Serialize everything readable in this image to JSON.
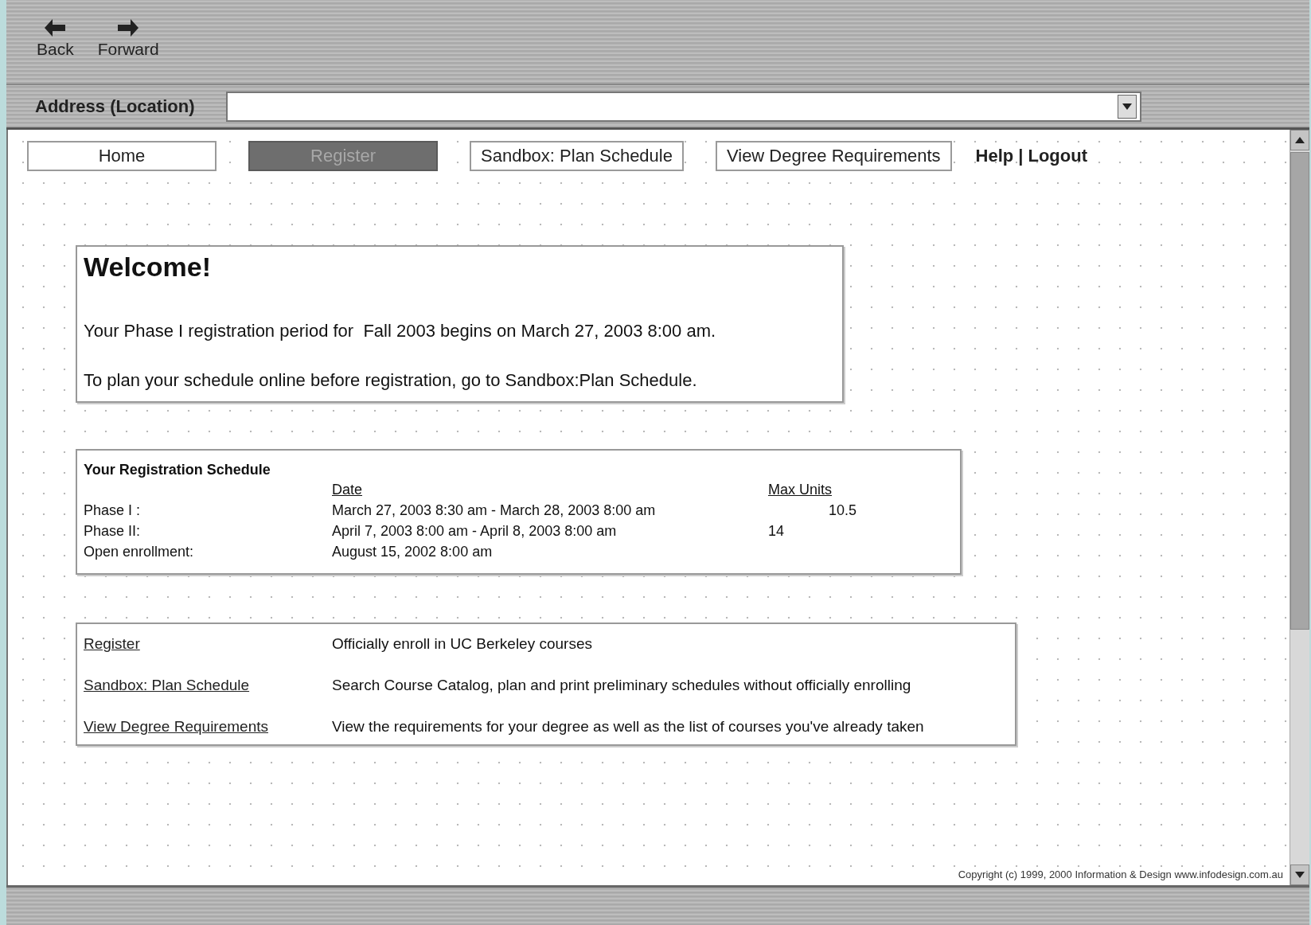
{
  "toolbar": {
    "buttons": [
      {
        "label": "Back",
        "kind": "back"
      },
      {
        "label": "Forward",
        "kind": "forward"
      }
    ]
  },
  "address_bar": {
    "label": "Address (Location)"
  },
  "nav": {
    "tabs": [
      {
        "label": "Home",
        "selected": false
      },
      {
        "label": "Register",
        "selected": true
      },
      {
        "label": "Sandbox: Plan Schedule",
        "selected": false
      },
      {
        "label": "View Degree Requirements",
        "selected": false
      }
    ],
    "links": [
      "Help",
      "Logout"
    ],
    "separator": "|"
  },
  "welcome": {
    "title": "Welcome!",
    "paragraphs": [
      "Your Phase I registration period for  Fall 2003 begins on March 27, 2003 8:00 am.",
      "To plan your schedule online before registration, go to Sandbox:Plan Schedule."
    ]
  },
  "schedule": {
    "title": "Your Registration Schedule",
    "columns": [
      "Date",
      "Max Units"
    ],
    "rows": [
      {
        "label": "Phase I :",
        "date": "March 27, 2003 8:30 am - March 28, 2003 8:00 am",
        "max_units": "10.5"
      },
      {
        "label": "Phase II:",
        "date": "April 7, 2003 8:00 am - April 8, 2003 8:00 am",
        "max_units": "14"
      },
      {
        "label": "Open enrollment:",
        "date": "August 15, 2002 8:00 am"
      }
    ]
  },
  "links": [
    {
      "link": "Register",
      "description": "Officially enroll in UC Berkeley courses"
    },
    {
      "link": "Sandbox: Plan Schedule",
      "description": "Search Course Catalog, plan and print preliminary schedules without officially enrolling"
    },
    {
      "link": "View Degree Requirements",
      "description": "View the requirements for your degree as well as the list of courses you've already taken"
    }
  ],
  "footer": {
    "copyright": "Copyright (c) 1999, 2000 Information & Design www.infodesign.com.au"
  }
}
